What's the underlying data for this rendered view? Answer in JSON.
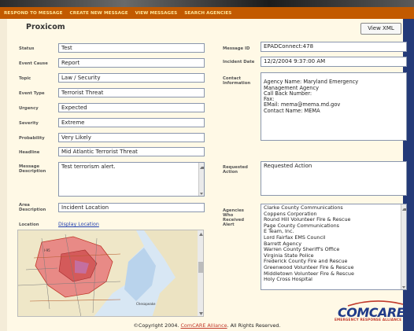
{
  "nav": {
    "items": [
      "RESPOND TO MESSAGE",
      "CREATE NEW MESSAGE",
      "VIEW MESSAGES",
      "SEARCH AGENCIES"
    ]
  },
  "page": {
    "title": "Proxicom",
    "view_xml_label": "View XML"
  },
  "form": {
    "status": {
      "label": "Status",
      "value": "Test"
    },
    "event_cause": {
      "label": "Event Cause",
      "value": "Report"
    },
    "topic": {
      "label": "Topic",
      "value": "Law / Security"
    },
    "event_type": {
      "label": "Event Type",
      "value": "Terrorist Threat"
    },
    "urgency": {
      "label": "Urgency",
      "value": "Expected"
    },
    "severity": {
      "label": "Severity",
      "value": "Extreme"
    },
    "probability": {
      "label": "Probability",
      "value": "Very Likely"
    },
    "headline": {
      "label": "Headline",
      "value": "Mid Atlantic Terrorist Threat"
    },
    "message_description": {
      "label": "Message Description",
      "value": "Test terrorism alert."
    },
    "area_description": {
      "label": "Area Description",
      "value": "Incident Location"
    },
    "location": {
      "label": "Location",
      "link": "Display Location"
    },
    "message_id": {
      "label": "Message ID",
      "value": "EPADConnect:478"
    },
    "incident_date": {
      "label": "Incident Date",
      "value": "12/2/2004 9:37:00 AM"
    },
    "contact_information": {
      "label": "Contact Information",
      "value": "Agency Name: Maryland Emergency\nManagement Agency\nCall Back Number:\nFax:\nEMail: mema@mema.md.gov\nContact Name: MEMA"
    },
    "requested_action": {
      "label": "Requested Action",
      "value": "Requested Action"
    },
    "agencies_received": {
      "label": "Agencies Who Received Alert",
      "items": [
        "Clarke County Communications",
        "Coppens Corporation",
        "Round Hill Volunteer Fire & Rescue",
        "Page County Communications",
        "E Team, Inc.",
        "Lord Fairfax EMS Council",
        "Barrett Agency",
        "Warren County Sheriff's Office",
        "Virginia State Police",
        "Frederick County Fire and Rescue",
        "Greenwood Volunteer Fire & Rescue",
        "Middletown Volunteer Fire & Rescue",
        "Holy Cross Hospital"
      ]
    }
  },
  "logo": {
    "word": "COMCARE",
    "tagline": "EMERGENCY RESPONSE ALLIANCE"
  },
  "footer": {
    "prefix": "©Copyright 2004. ",
    "link": "ComCARE Alliance",
    "suffix": ". All Rights Reserved."
  },
  "colors": {
    "nav_bg": "#c25a00",
    "nav_text": "#ffe79a",
    "panel_bg": "#fff9e6",
    "right_bar": "#243a78",
    "field_border": "#8a96ad",
    "link": "#1f3fb0",
    "logo_blue": "#1f3a88",
    "logo_red": "#c0392b"
  },
  "icons": [
    "scroll-up-arrow-icon",
    "scroll-down-arrow-icon",
    "map-image"
  ]
}
